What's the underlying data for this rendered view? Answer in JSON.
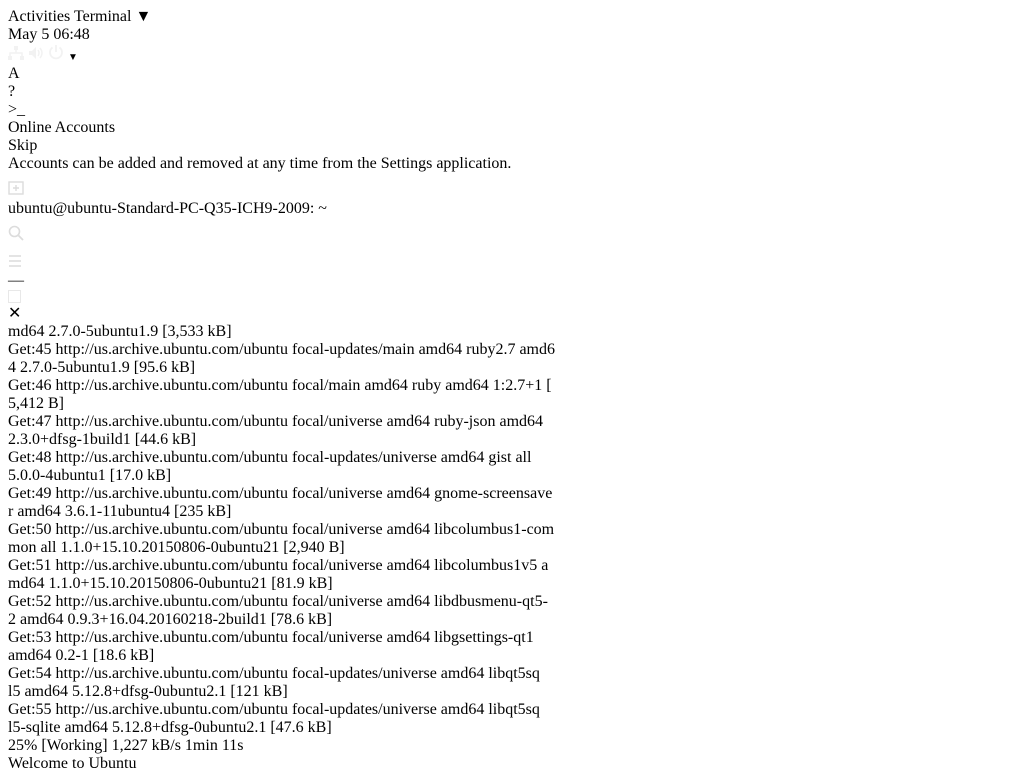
{
  "topbar": {
    "activities": "Activities",
    "app_name": "Terminal",
    "clock": "May 5  06:48"
  },
  "tooltip": "Welcome to Ubuntu",
  "bg_window": {
    "title": "Online Accounts",
    "skip": "Skip",
    "footnote": "Accounts can be added and removed at any time from the Settings application."
  },
  "terminal": {
    "title": "ubuntu@ubuntu-Standard-PC-Q35-ICH9-2009: ~",
    "lines": [
      "md64 2.7.0-5ubuntu1.9 [3,533 kB]",
      "Get:45 http://us.archive.ubuntu.com/ubuntu focal-updates/main amd64 ruby2.7 amd6",
      "4 2.7.0-5ubuntu1.9 [95.6 kB]",
      "Get:46 http://us.archive.ubuntu.com/ubuntu focal/main amd64 ruby amd64 1:2.7+1 [",
      "5,412 B]",
      "Get:47 http://us.archive.ubuntu.com/ubuntu focal/universe amd64 ruby-json amd64",
      "2.3.0+dfsg-1build1 [44.6 kB]",
      "Get:48 http://us.archive.ubuntu.com/ubuntu focal-updates/universe amd64 gist all",
      " 5.0.0-4ubuntu1 [17.0 kB]",
      "Get:49 http://us.archive.ubuntu.com/ubuntu focal/universe amd64 gnome-screensave",
      "r amd64 3.6.1-11ubuntu4 [235 kB]",
      "Get:50 http://us.archive.ubuntu.com/ubuntu focal/universe amd64 libcolumbus1-com",
      "mon all 1.1.0+15.10.20150806-0ubuntu21 [2,940 B]",
      "Get:51 http://us.archive.ubuntu.com/ubuntu focal/universe amd64 libcolumbus1v5 a",
      "md64 1.1.0+15.10.20150806-0ubuntu21 [81.9 kB]",
      "Get:52 http://us.archive.ubuntu.com/ubuntu focal/universe amd64 libdbusmenu-qt5-",
      "2 amd64 0.9.3+16.04.20160218-2build1 [78.6 kB]",
      "Get:53 http://us.archive.ubuntu.com/ubuntu focal/universe amd64 libgsettings-qt1",
      " amd64 0.2-1 [18.6 kB]",
      "Get:54 http://us.archive.ubuntu.com/ubuntu focal-updates/universe amd64 libqt5sq",
      "l5 amd64 5.12.8+dfsg-0ubuntu2.1 [121 kB]",
      "Get:55 http://us.archive.ubuntu.com/ubuntu focal-updates/universe amd64 libqt5sq",
      "l5-sqlite amd64 5.12.8+dfsg-0ubuntu2.1 [47.6 kB]"
    ],
    "status_left": "25% [Working]",
    "status_right": "1,227 kB/s 1min 11s"
  },
  "dock": [
    {
      "name": "firefox-icon",
      "running": false,
      "active": false
    },
    {
      "name": "files-icon",
      "running": false,
      "active": false
    },
    {
      "name": "software-icon",
      "running": true,
      "active": false
    },
    {
      "name": "help-icon",
      "running": false,
      "active": false
    },
    {
      "name": "welcome-icon",
      "running": true,
      "active": true
    },
    {
      "name": "terminal-icon",
      "running": true,
      "active": true
    }
  ],
  "icons": {
    "network": "network-icon",
    "volume": "volume-icon",
    "power": "power-icon",
    "apps": "show-apps-icon"
  }
}
